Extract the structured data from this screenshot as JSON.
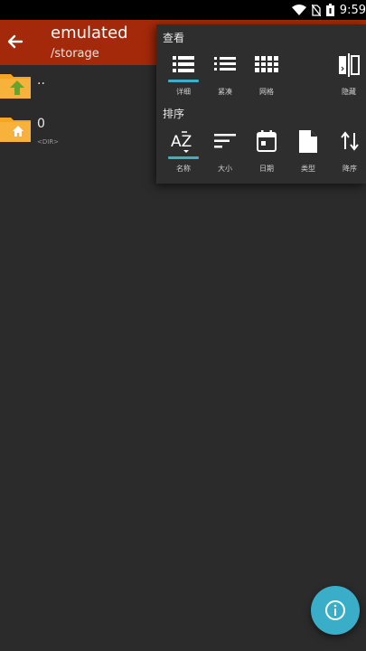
{
  "status_bar": {
    "time": "9:59"
  },
  "app_bar": {
    "title": "emulated",
    "subtitle": "/storage"
  },
  "file_list": [
    {
      "name": "..",
      "sub": ""
    },
    {
      "name": "0",
      "sub": "<DIR>"
    }
  ],
  "view_menu": {
    "view_label": "查看",
    "view_options": [
      {
        "label": "详细",
        "selected": true
      },
      {
        "label": "紧凑",
        "selected": false
      },
      {
        "label": "网格",
        "selected": false
      },
      {
        "label": "隐藏",
        "selected": false
      }
    ],
    "sort_label": "排序",
    "sort_options": [
      {
        "label": "名称",
        "selected": true
      },
      {
        "label": "大小",
        "selected": false
      },
      {
        "label": "日期",
        "selected": false
      },
      {
        "label": "类型",
        "selected": false
      },
      {
        "label": "降序",
        "selected": false
      }
    ]
  },
  "colors": {
    "app_bar": "#a3290a",
    "accent": "#3aaec8",
    "folder": "#f5a623",
    "background": "#2b2b2b"
  }
}
